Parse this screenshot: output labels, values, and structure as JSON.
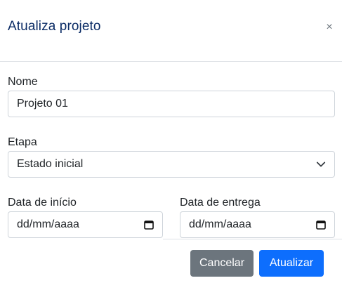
{
  "modal": {
    "title": "Atualiza projeto",
    "close_symbol": "×"
  },
  "form": {
    "nome": {
      "label": "Nome",
      "value": "Projeto 01"
    },
    "etapa": {
      "label": "Etapa",
      "selected": "Estado inicial",
      "icon": "chevron-down-icon"
    },
    "data_inicio": {
      "label": "Data de início",
      "value": "dd/mm/aaaa",
      "icon": "calendar-icon"
    },
    "data_entrega": {
      "label": "Data de entrega",
      "value": "dd/mm/aaaa",
      "icon": "calendar-icon"
    }
  },
  "buttons": {
    "cancel_label": "Cancelar",
    "update_label": "Atualizar"
  },
  "colors": {
    "title": "#0b2c66",
    "primary": "#0d6efd",
    "secondary": "#6c757d",
    "border": "#ced4da"
  }
}
